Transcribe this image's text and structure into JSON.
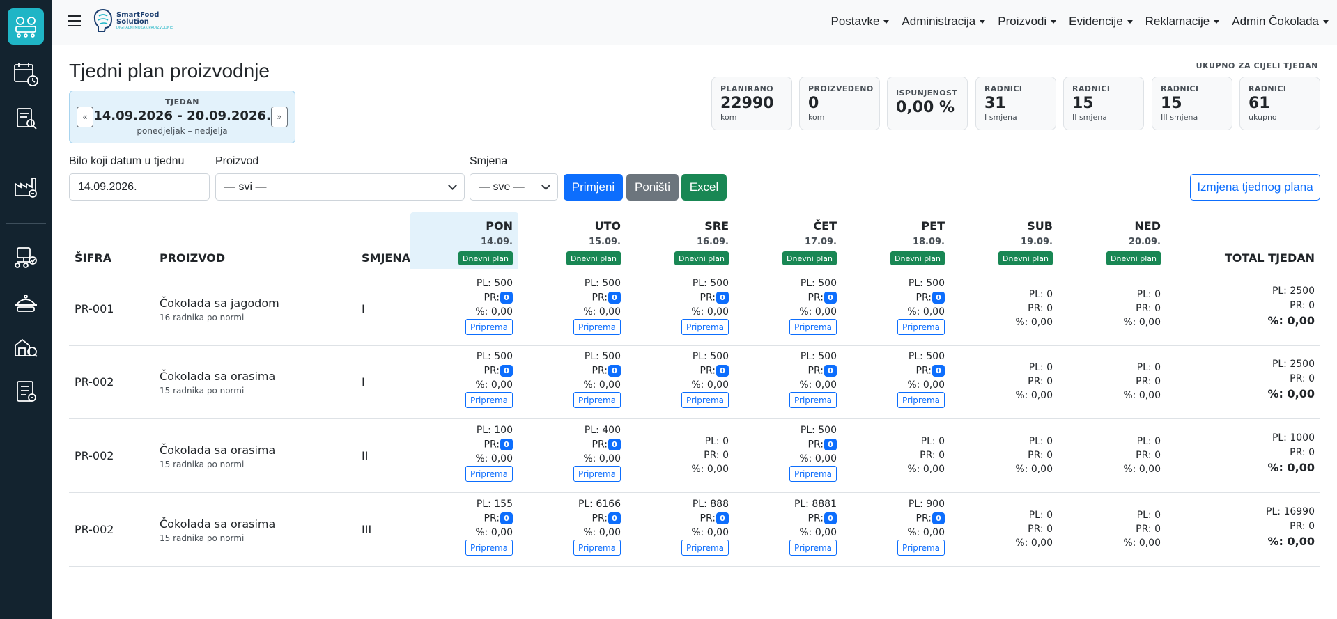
{
  "brand": {
    "line1": "SmartFood",
    "line2": "Solution",
    "line3": "DIGITALNI MOZAK PROIZVODNJE"
  },
  "menu": [
    "Postavke",
    "Administracija",
    "Proizvodi",
    "Evidencije",
    "Reklamacije",
    "Admin Čokolada"
  ],
  "sidebar": {
    "icons": [
      "production-line-icon",
      "calendar-clock-icon",
      "report-search-icon",
      "factory-icon",
      "warehouse-network-icon",
      "food-tray-icon",
      "quality-check-icon",
      "checklist-icon"
    ]
  },
  "page": {
    "title": "Tjedni plan proizvodnje"
  },
  "week": {
    "caption": "TJEDAN",
    "range": "14.09.2026 - 20.09.2026.",
    "days": "ponedjeljak – nedjelja",
    "prev": "«",
    "next": "»"
  },
  "totals_caption": "UKUPNO ZA CIJELI TJEDAN",
  "stats": [
    {
      "label": "PLANIRANO",
      "value": "22990",
      "sub": "kom"
    },
    {
      "label": "PROIZVEDENO",
      "value": "0",
      "sub": "kom"
    },
    {
      "label": "ISPUNJENOST",
      "value": "0,00 %",
      "sub": ""
    },
    {
      "label": "RADNICI",
      "value": "31",
      "sub": "I smjena"
    },
    {
      "label": "RADNICI",
      "value": "15",
      "sub": "II smjena"
    },
    {
      "label": "RADNICI",
      "value": "15",
      "sub": "III smjena"
    },
    {
      "label": "RADNICI",
      "value": "61",
      "sub": "ukupno"
    }
  ],
  "filters": {
    "date_label": "Bilo koji datum u tjednu",
    "date_value": "14.09.2026.",
    "product_label": "Proizvod",
    "product_value": "— svi —",
    "shift_label": "Smjena",
    "shift_value": "— sve —",
    "apply": "Primjeni",
    "reset": "Poništi",
    "excel": "Excel",
    "edit_plan": "Izmjena tjednog plana"
  },
  "table": {
    "headers": {
      "code": "ŠIFRA",
      "product": "PROIZVOD",
      "shift": "SMJENA",
      "total": "TOTAL TJEDAN"
    },
    "days": [
      {
        "name": "PON",
        "date": "14.09.",
        "badge": "Dnevni plan"
      },
      {
        "name": "UTO",
        "date": "15.09.",
        "badge": "Dnevni plan"
      },
      {
        "name": "SRE",
        "date": "16.09.",
        "badge": "Dnevni plan"
      },
      {
        "name": "ČET",
        "date": "17.09.",
        "badge": "Dnevni plan"
      },
      {
        "name": "PET",
        "date": "18.09.",
        "badge": "Dnevni plan"
      },
      {
        "name": "SUB",
        "date": "19.09.",
        "badge": "Dnevni plan"
      },
      {
        "name": "NED",
        "date": "20.09.",
        "badge": "Dnevni plan"
      }
    ],
    "labels": {
      "pl": "PL:",
      "pr": "PR:",
      "pct": "%:",
      "prep": "Priprema"
    },
    "rows": [
      {
        "code": "PR-001",
        "name": "Čokolada sa jagodom",
        "norm": "16 radnika po normi",
        "shift": "I",
        "cells": [
          {
            "pl": "500",
            "pr": "0",
            "pct": "0,00",
            "active": true
          },
          {
            "pl": "500",
            "pr": "0",
            "pct": "0,00",
            "active": true
          },
          {
            "pl": "500",
            "pr": "0",
            "pct": "0,00",
            "active": true
          },
          {
            "pl": "500",
            "pr": "0",
            "pct": "0,00",
            "active": true
          },
          {
            "pl": "500",
            "pr": "0",
            "pct": "0,00",
            "active": true
          },
          {
            "pl": "0",
            "pr": "0",
            "pct": "0,00",
            "active": false
          },
          {
            "pl": "0",
            "pr": "0",
            "pct": "0,00",
            "active": false
          }
        ],
        "total": {
          "pl": "2500",
          "pr": "0",
          "pct": "0,00"
        }
      },
      {
        "code": "PR-002",
        "name": "Čokolada sa orasima",
        "norm": "15 radnika po normi",
        "shift": "I",
        "cells": [
          {
            "pl": "500",
            "pr": "0",
            "pct": "0,00",
            "active": true
          },
          {
            "pl": "500",
            "pr": "0",
            "pct": "0,00",
            "active": true
          },
          {
            "pl": "500",
            "pr": "0",
            "pct": "0,00",
            "active": true
          },
          {
            "pl": "500",
            "pr": "0",
            "pct": "0,00",
            "active": true
          },
          {
            "pl": "500",
            "pr": "0",
            "pct": "0,00",
            "active": true
          },
          {
            "pl": "0",
            "pr": "0",
            "pct": "0,00",
            "active": false
          },
          {
            "pl": "0",
            "pr": "0",
            "pct": "0,00",
            "active": false
          }
        ],
        "total": {
          "pl": "2500",
          "pr": "0",
          "pct": "0,00"
        }
      },
      {
        "code": "PR-002",
        "name": "Čokolada sa orasima",
        "norm": "15 radnika po normi",
        "shift": "II",
        "cells": [
          {
            "pl": "100",
            "pr": "0",
            "pct": "0,00",
            "active": true
          },
          {
            "pl": "400",
            "pr": "0",
            "pct": "0,00",
            "active": true
          },
          {
            "pl": "0",
            "pr": "0",
            "pct": "0,00",
            "active": false
          },
          {
            "pl": "500",
            "pr": "0",
            "pct": "0,00",
            "active": true
          },
          {
            "pl": "0",
            "pr": "0",
            "pct": "0,00",
            "active": false
          },
          {
            "pl": "0",
            "pr": "0",
            "pct": "0,00",
            "active": false
          },
          {
            "pl": "0",
            "pr": "0",
            "pct": "0,00",
            "active": false
          }
        ],
        "total": {
          "pl": "1000",
          "pr": "0",
          "pct": "0,00"
        }
      },
      {
        "code": "PR-002",
        "name": "Čokolada sa orasima",
        "norm": "15 radnika po normi",
        "shift": "III",
        "cells": [
          {
            "pl": "155",
            "pr": "0",
            "pct": "0,00",
            "active": true
          },
          {
            "pl": "6166",
            "pr": "0",
            "pct": "0,00",
            "active": true
          },
          {
            "pl": "888",
            "pr": "0",
            "pct": "0,00",
            "active": true
          },
          {
            "pl": "8881",
            "pr": "0",
            "pct": "0,00",
            "active": true
          },
          {
            "pl": "900",
            "pr": "0",
            "pct": "0,00",
            "active": true
          },
          {
            "pl": "0",
            "pr": "0",
            "pct": "0,00",
            "active": false
          },
          {
            "pl": "0",
            "pr": "0",
            "pct": "0,00",
            "active": false
          }
        ],
        "total": {
          "pl": "16990",
          "pr": "0",
          "pct": "0,00"
        }
      }
    ]
  }
}
